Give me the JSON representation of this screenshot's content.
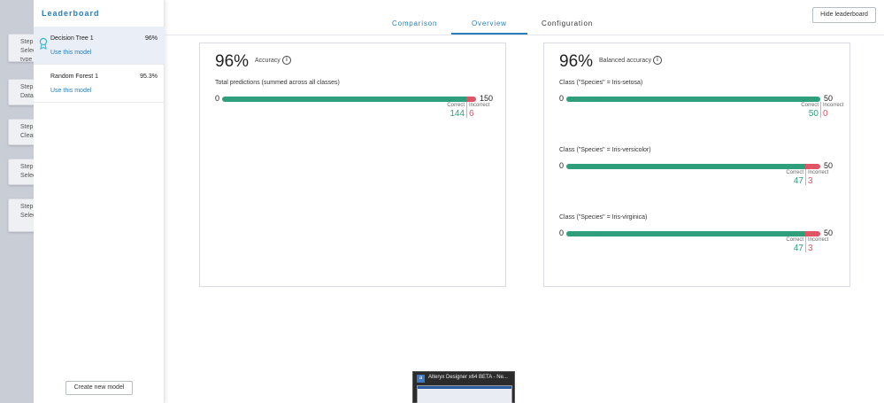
{
  "background_steps": [
    {
      "label": "Step",
      "sub": "Selec"
    },
    {
      "label": "Step",
      "sub": "Data"
    },
    {
      "label": "Step",
      "sub": "Clear"
    },
    {
      "label": "Step",
      "sub": "Selec"
    },
    {
      "label": "Step",
      "sub": "Selec"
    }
  ],
  "background_step_extra": "type",
  "sidebar": {
    "title": "Leaderboard",
    "models": [
      {
        "name": "Decision Tree 1",
        "score": "96%",
        "action": "Use this model",
        "selected": true
      },
      {
        "name": "Random Forest 1",
        "score": "95.3%",
        "action": "Use this model",
        "selected": false
      }
    ],
    "create_button": "Create new model"
  },
  "tabs": [
    {
      "label": "Comparison",
      "active": false
    },
    {
      "label": "Overview",
      "active": true
    },
    {
      "label": "Configuration",
      "active": false
    }
  ],
  "hide_button": "Hide leaderboard",
  "accuracy_panel": {
    "value": "96%",
    "label": "Accuracy",
    "bars": [
      {
        "title": "Total predictions (summed across all classes)",
        "zero": "0",
        "total": "150",
        "correct": 144,
        "incorrect": 6,
        "correct_label": "Correct",
        "incorrect_label": "Incorrect"
      }
    ]
  },
  "balanced_panel": {
    "value": "96%",
    "label": "Balanced accuracy",
    "bars": [
      {
        "title": "Class (\"Species\" = Iris-setosa)",
        "zero": "0",
        "total": "50",
        "correct": 50,
        "incorrect": 0,
        "correct_label": "Correct",
        "incorrect_label": "Incorrect"
      },
      {
        "title": "Class (\"Species\" = Iris-versicolor)",
        "zero": "0",
        "total": "50",
        "correct": 47,
        "incorrect": 3,
        "correct_label": "Correct",
        "incorrect_label": "Incorrect"
      },
      {
        "title": "Class (\"Species\" = Iris-virginica)",
        "zero": "0",
        "total": "50",
        "correct": 47,
        "incorrect": 3,
        "correct_label": "Correct",
        "incorrect_label": "Incorrect"
      }
    ]
  },
  "taskbar_thumbnail": {
    "title": "Alteryx Designer x64 BETA - Ne...",
    "icon": "alteryx-icon"
  },
  "colors": {
    "accent": "#2a7fb8",
    "correct": "#2e9e7b",
    "incorrect": "#e05565"
  }
}
